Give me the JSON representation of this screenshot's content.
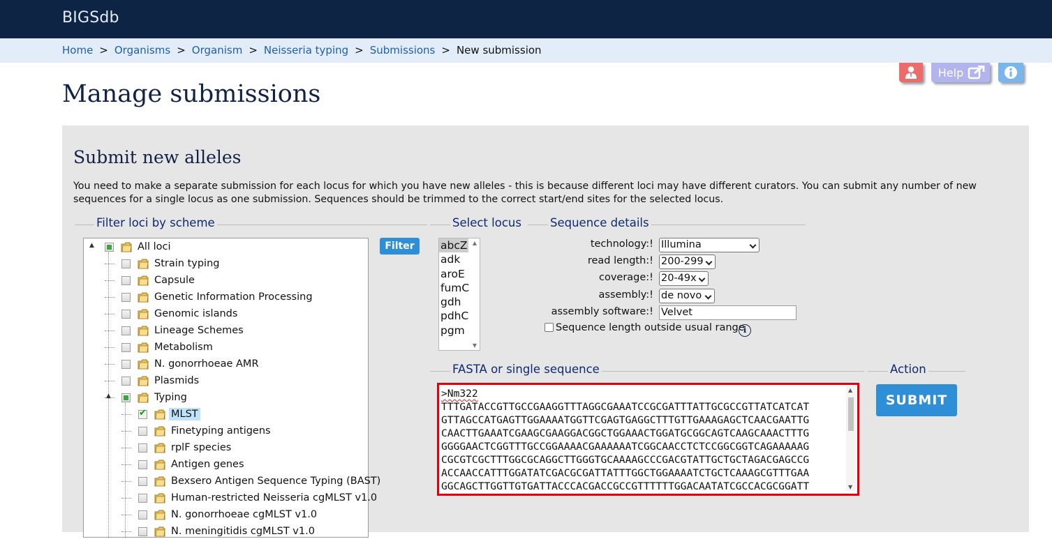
{
  "app": {
    "title": "BIGSdb"
  },
  "breadcrumb": {
    "items": [
      "Home",
      "Organisms",
      "Organism",
      "Neisseria typing",
      "Submissions"
    ],
    "current": "New submission",
    "separator": ">"
  },
  "toolbar": {
    "user_icon": "user-icon",
    "help_label": "Help",
    "help_icon": "external-link-icon",
    "info_icon": "info-icon"
  },
  "page": {
    "title": "Manage submissions"
  },
  "section": {
    "title": "Submit new alleles",
    "intro": "You need to make a separate submission for each locus for which you have new alleles - this is because different loci may have different curators. You can submit any number of new sequences for a single locus as one submission. Sequences should be trimmed to the correct start/end sites for the selected locus."
  },
  "filter": {
    "legend": "Filter loci by scheme",
    "button_label": "Filter",
    "tree": [
      {
        "label": "All loci",
        "state": "partial"
      },
      {
        "label": "Strain typing",
        "state": "unchecked"
      },
      {
        "label": "Capsule",
        "state": "unchecked"
      },
      {
        "label": "Genetic Information Processing",
        "state": "unchecked"
      },
      {
        "label": "Genomic islands",
        "state": "unchecked"
      },
      {
        "label": "Lineage Schemes",
        "state": "unchecked"
      },
      {
        "label": "Metabolism",
        "state": "unchecked"
      },
      {
        "label": "N. gonorrhoeae AMR",
        "state": "unchecked"
      },
      {
        "label": "Plasmids",
        "state": "unchecked"
      },
      {
        "label": "Typing",
        "state": "partial"
      },
      {
        "label": "MLST",
        "state": "checked"
      },
      {
        "label": "Finetyping antigens",
        "state": "unchecked"
      },
      {
        "label": "rplF species",
        "state": "unchecked"
      },
      {
        "label": "Antigen genes",
        "state": "unchecked"
      },
      {
        "label": "Bexsero Antigen Sequence Typing (BAST)",
        "state": "unchecked"
      },
      {
        "label": "Human-restricted Neisseria cgMLST v1.0",
        "state": "unchecked"
      },
      {
        "label": "N. gonorrhoeae cgMLST v1.0",
        "state": "unchecked"
      },
      {
        "label": "N. meningitidis cgMLST v1.0",
        "state": "unchecked"
      }
    ]
  },
  "locus": {
    "legend": "Select locus",
    "options": [
      "abcZ",
      "adk",
      "aroE",
      "fumC",
      "gdh",
      "pdhC",
      "pgm"
    ],
    "selected": "abcZ"
  },
  "sequence_details": {
    "legend": "Sequence details",
    "technology_label": "technology:!",
    "technology_value": "Illumina",
    "read_length_label": "read length:!",
    "read_length_value": "200-299",
    "coverage_label": "coverage:!",
    "coverage_value": "20-49x",
    "assembly_label": "assembly:!",
    "assembly_value": "de novo",
    "software_label": "assembly software:!",
    "software_value": "Velvet",
    "length_check_label": "Sequence length outside usual range",
    "length_check_checked": false,
    "info_icon": "info-icon"
  },
  "fasta": {
    "legend": "FASTA or single sequence",
    "header": ">Nm322",
    "lines": [
      "TTTGATACCGTTGCCGAAGGTTTAGGCGAAATCCGCGATTTATTGCGCCGTTATCATCAT",
      "GTTAGCCATGAGTTGGAAAATGGTTCGAGTGAGGCTTTGTTGAAAGAGCTCAACGAATTG",
      "CAACTTGAAATCGAAGCGAAGGACGGCTGGAAACTGGATGCGGCAGTCAAGCAAACTTTG",
      "GGGGAACTCGGTTTGCCGGAAAACGAAAAAATCGGCAACCTCTCCGGCGGTCAGAAAAAG",
      "CGCGTCGCTTTGGCGCAGGCTTGGGTGCAAAAGCCCGACGTATTGCTGCTAGACGAGCCG",
      "ACCAACCATTTGGATATCGACGCGATTATTTGGCTGGAAAATCTGCTCAAAGCGTTTGAA",
      "GGCAGCTTGGTTGTGATTACCCACGACCGCCGTTTTTTGGACAATATCGCCACGCGGATT"
    ]
  },
  "action": {
    "legend": "Action",
    "submit_label": "SUBMIT"
  },
  "colors": {
    "header_bg": "#0d2444",
    "breadcrumb_bg": "#e3edf9",
    "panel_bg": "#e6e6e6",
    "accent_button": "#2e8ed6",
    "fasta_border": "#e0000f"
  }
}
